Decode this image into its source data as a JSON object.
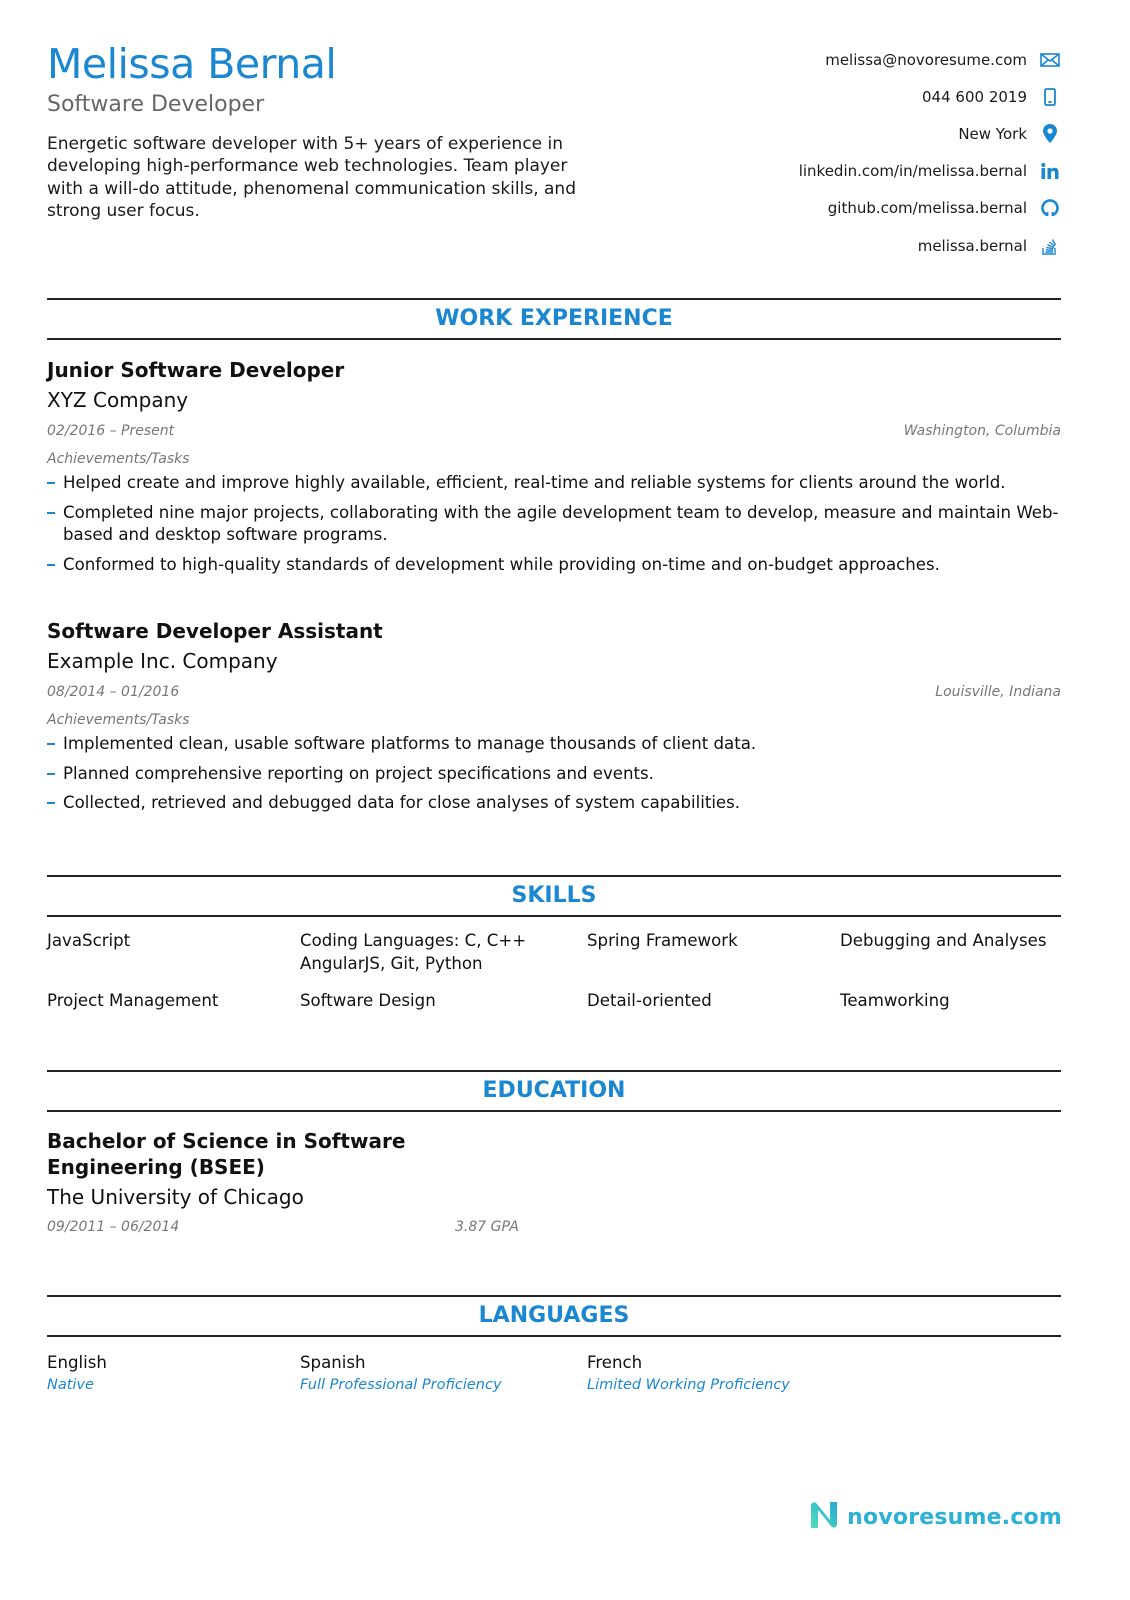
{
  "header": {
    "name": "Melissa Bernal",
    "title": "Software Developer",
    "summary": "Energetic software developer with 5+ years of experience in developing high-performance web technologies. Team player with a will-do attitude, phenomenal communication skills, and strong user focus."
  },
  "contacts": [
    {
      "text": "melissa@novoresume.com",
      "icon": "envelope-icon"
    },
    {
      "text": "044 600 2019",
      "icon": "mobile-phone-icon"
    },
    {
      "text": "New York",
      "icon": "map-pin-icon"
    },
    {
      "text": "linkedin.com/in/melissa.bernal",
      "icon": "linkedin-icon"
    },
    {
      "text": "github.com/melissa.bernal",
      "icon": "github-icon"
    },
    {
      "text": "melissa.bernal",
      "icon": "stackoverflow-icon"
    }
  ],
  "work": {
    "heading": "WORK EXPERIENCE",
    "jobs": [
      {
        "title": "Junior Software Developer",
        "company": "XYZ Company",
        "dates": "02/2016 – Present",
        "location": "Washington, Columbia",
        "subheading": "Achievements/Tasks",
        "bullets": [
          "Helped create and improve highly available, efficient, real-time and reliable systems for clients around the world.",
          "Completed nine major projects, collaborating with the agile development team to develop, measure and maintain Web-based and desktop software programs.",
          "Conformed to high-quality standards of development while providing on-time and on-budget approaches."
        ]
      },
      {
        "title": "Software Developer Assistant",
        "company": "Example Inc. Company",
        "dates": "08/2014 – 01/2016",
        "location": "Louisville, Indiana",
        "subheading": "Achievements/Tasks",
        "bullets": [
          "Implemented clean, usable software platforms to manage thousands of client data.",
          "Planned comprehensive reporting on project specifications and events.",
          "Collected, retrieved and debugged data for close analyses of system capabilities."
        ]
      }
    ]
  },
  "skills": {
    "heading": "SKILLS",
    "rows": [
      [
        "JavaScript",
        "Coding Languages: C, C++ AngularJS, Git, Python",
        "Spring Framework",
        "Debugging and Analyses"
      ],
      [
        "Project Management",
        "Software Design",
        "Detail-oriented",
        "Teamworking"
      ]
    ]
  },
  "education": {
    "heading": "EDUCATION",
    "degree": "Bachelor of Science in Software Engineering (BSEE)",
    "school": "The University of Chicago",
    "dates": "09/2011 – 06/2014",
    "gpa": "3.87 GPA"
  },
  "languages": {
    "heading": "LANGUAGES",
    "items": [
      {
        "name": "English",
        "level": "Native"
      },
      {
        "name": "Spanish",
        "level": "Full Professional Proficiency"
      },
      {
        "name": "French",
        "level": "Limited Working Proficiency"
      }
    ]
  },
  "footer": {
    "brand": "novoresume.com"
  },
  "colors": {
    "accent": "#1a87d0",
    "brand": "#2bb0d8",
    "meta_text": "#777777"
  }
}
